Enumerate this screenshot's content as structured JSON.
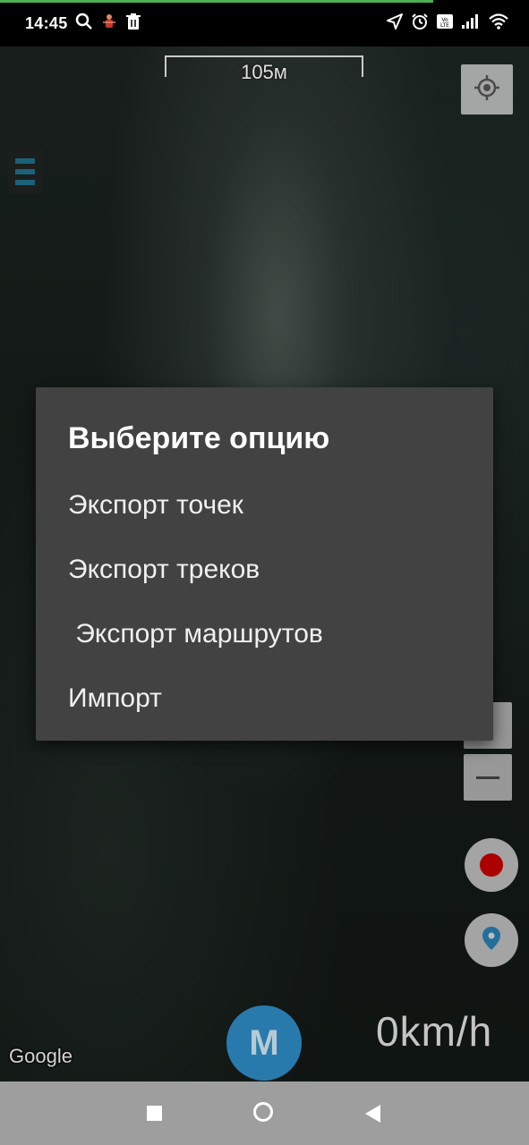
{
  "status_bar": {
    "time": "14:45",
    "left_icons": [
      "search-icon",
      "bug-icon",
      "trash-icon"
    ],
    "right_icons": [
      "location-arrow-icon",
      "alarm-icon",
      "volte-icon",
      "signal-icon",
      "wifi-icon"
    ]
  },
  "map": {
    "scale_label": "105м",
    "speed": "0km/h",
    "attribution": "Google",
    "fab_letter": "M"
  },
  "dialog": {
    "title": "Выберите опцию",
    "items": [
      "Экспорт точек",
      "Экспорт треков",
      " Экспорт маршрутов",
      "Импорт"
    ]
  },
  "colors": {
    "dialog_bg": "#424242",
    "fab": "#2e8bc4",
    "record": "#c40000",
    "menu_accent": "#1f6f8b",
    "nav_bar": "#9e9e9e"
  }
}
